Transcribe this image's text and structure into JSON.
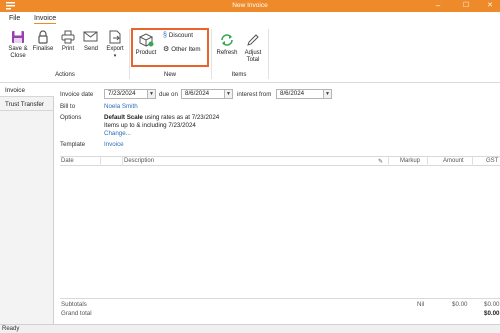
{
  "window": {
    "title": "New Invoice",
    "minimize": "–",
    "maximize": "☐",
    "close": "✕"
  },
  "menu": {
    "tabs": [
      "File",
      "Invoice"
    ]
  },
  "ribbon": {
    "actions": {
      "save_close": [
        "Save &",
        "Close"
      ],
      "finalise": "Finalise",
      "print": "Print",
      "send": "Send",
      "export": "Export",
      "export_arrow": "▾",
      "group_label": "Actions"
    },
    "new": {
      "product": "Product",
      "discount": "Discount",
      "other_item": "Other Item",
      "group_label": "New"
    },
    "items": {
      "refresh": "Refresh",
      "adjust_total": [
        "Adjust",
        "Total"
      ],
      "group_label": "Items"
    },
    "accent_color": "#e8642c"
  },
  "left_tabs": [
    "Invoice",
    "Trust Transfer"
  ],
  "form": {
    "invoice_date_label": "Invoice date",
    "invoice_date": "7/23/2024",
    "due_on_label": "due on",
    "due_on": "8/6/2024",
    "interest_from_label": "interest from",
    "interest_from": "8/6/2024",
    "bill_to_label": "Bill to",
    "bill_to": "Noela Smith",
    "options_label": "Options",
    "options_line1_bold": "Default Scale",
    "options_line1_rest": " using rates as at 7/23/2024",
    "options_line2": "Items up to & including 7/23/2024",
    "options_change": "Change...",
    "template_label": "Template",
    "template": "Invoice"
  },
  "grid": {
    "columns": [
      "Date",
      "Description",
      "Markup",
      "Amount",
      "GST"
    ],
    "edit_icon": "✎"
  },
  "totals": {
    "subtotals_label": "Subtotals",
    "subtotal_markup": "Nil",
    "subtotal_amount": "$0.00",
    "subtotal_gst": "$0.00",
    "grand_total_label": "Grand total",
    "grand_total": "$0.00"
  },
  "status": "Ready"
}
